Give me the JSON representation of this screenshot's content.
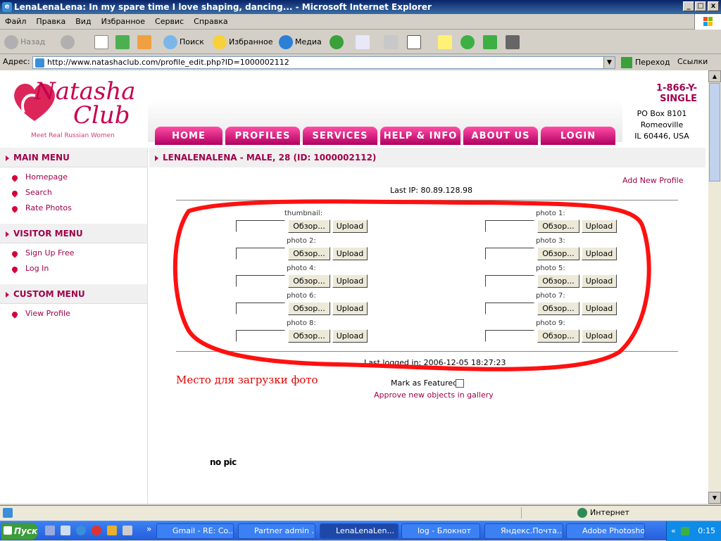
{
  "window": {
    "title": "LenaLenaLena: In my spare time I love shaping, dancing... - Microsoft Internet Explorer",
    "min": "_",
    "max": "□",
    "close": "x"
  },
  "menu": [
    "Файл",
    "Правка",
    "Вид",
    "Избранное",
    "Сервис",
    "Справка"
  ],
  "toolbar": {
    "back": "Назад",
    "search": "Поиск",
    "favorites": "Избранное",
    "media": "Медиа"
  },
  "address": {
    "label": "Адрес:",
    "url": "http://www.natashaclub.com/profile_edit.php?ID=1000002112",
    "go": "Переход",
    "links": "Ссылки"
  },
  "site": {
    "logo_top": "Natasha",
    "logo_bottom": "Club",
    "slogan": "Meet Real Russian Women",
    "phone": "1-866-Y-SINGLE",
    "address_lines": [
      "PO Box 8101",
      "Romeoville",
      "IL 60446, USA"
    ],
    "nav": [
      "HOME",
      "PROFILES",
      "SERVICES",
      "HELP & INFO",
      "ABOUT US",
      "LOGIN"
    ]
  },
  "sidebar": {
    "main_menu": {
      "title": "MAIN MENU",
      "items": [
        "Homepage",
        "Search",
        "Rate Photos"
      ]
    },
    "visitor_menu": {
      "title": "VISITOR MENU",
      "items": [
        "Sign Up Free",
        "Log In"
      ]
    },
    "custom_menu": {
      "title": "CUSTOM MENU",
      "items": [
        "View Profile"
      ]
    }
  },
  "main": {
    "heading": "LENALENALENA - MALE, 28 (ID: 1000002112)",
    "add_new_profile": "Add New Profile",
    "last_ip": "Last IP: 80.89.128.98",
    "browse_label": "Обзор...",
    "upload_label": "Upload",
    "photos_left": [
      "thumbnail:",
      "photo 2:",
      "photo 4:",
      "photo 6:",
      "photo 8:"
    ],
    "photos_right": [
      "photo 1:",
      "photo 3:",
      "photo 5:",
      "photo 7:",
      "photo 9:"
    ],
    "last_logged": "Last logged in: 2006-12-05 18:27:23",
    "annotation": "Место для загрузки фото",
    "mark_featured": "Mark as Featured",
    "approve": "Approve new objects in gallery",
    "nopic": "no pic"
  },
  "status": {
    "zone": "Интернет"
  },
  "taskbar": {
    "start": "Пуск",
    "items": [
      "Gmail - RE: Co...",
      "Partner admin ...",
      "LenaLenaLen...",
      "log - Блокнот",
      "Яндекс.Почта...",
      "Adobe Photoshop"
    ],
    "clock": "0:15"
  },
  "colors": {
    "brand": "#c70050",
    "nav_tab": "#e0207a",
    "annotation_red": "#e00000"
  }
}
